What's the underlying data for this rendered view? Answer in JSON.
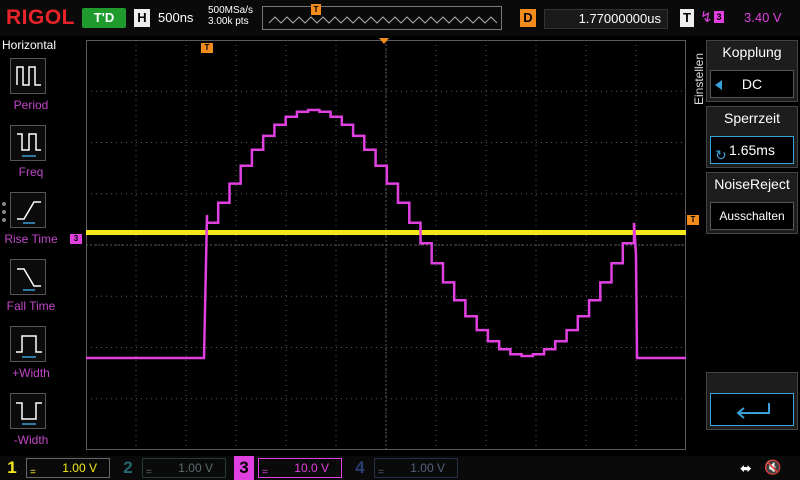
{
  "header": {
    "brand": "RIGOL",
    "run_status": "T'D",
    "horizontal_label": "H",
    "timebase": "500ns",
    "sample_rate": "500MSa/s",
    "memory_depth": "3.00k pts",
    "trigger_pos_marker": "T",
    "delay_label": "D",
    "delay_value": "1.77000000us",
    "trigger_label": "T",
    "trigger_source": "3",
    "trigger_level": "3.40 V"
  },
  "left_panel": {
    "title": "Horizontal",
    "items": [
      {
        "label": "Period",
        "icon": "period-icon"
      },
      {
        "label": "Freq",
        "icon": "frequency-icon"
      },
      {
        "label": "Rise Time",
        "icon": "rise-time-icon"
      },
      {
        "label": "Fall Time",
        "icon": "fall-time-icon"
      },
      {
        "label": "+Width",
        "icon": "positive-width-icon"
      },
      {
        "label": "-Width",
        "icon": "negative-width-icon"
      }
    ]
  },
  "right_panel": {
    "menu_title": "Einstellen",
    "coupling_title": "Kopplung",
    "coupling_value": "DC",
    "holdoff_title": "Sperrzeit",
    "holdoff_value": "1.65ms",
    "noise_title": "NoiseReject",
    "noise_value": "Ausschalten"
  },
  "grid_markers": {
    "trigger_time": "T",
    "ch3_ground": "3",
    "trigger_level": "T"
  },
  "channels": [
    {
      "num": "1",
      "coupling": "=",
      "scale": "1.00 V",
      "color": "#f4e81c",
      "active": true
    },
    {
      "num": "2",
      "coupling": "=",
      "scale": "1.00 V",
      "color": "#2fb8c0",
      "active": false
    },
    {
      "num": "3",
      "coupling": "=",
      "scale": "10.0 V",
      "color": "#e040e0",
      "active": true
    },
    {
      "num": "4",
      "coupling": "=",
      "scale": "1.00 V",
      "color": "#3a6dd8",
      "active": false
    }
  ],
  "colors": {
    "ch1": "#f4e81c",
    "ch3": "#e040e0",
    "trigger": "#f18b1e",
    "accent": "#3aa0d8",
    "grid": "#5a5a5a"
  }
}
